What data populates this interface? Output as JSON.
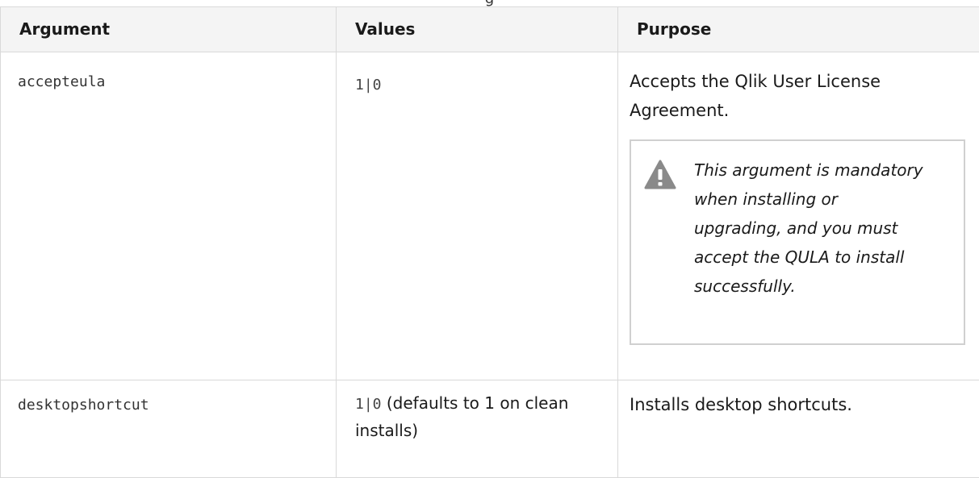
{
  "caption": "g",
  "table": {
    "headers": [
      "Argument",
      "Values",
      "Purpose"
    ],
    "rows": [
      {
        "argument": "accepteula",
        "values_code": "1|0",
        "values_note": "",
        "purpose": "Accepts the Qlik User License Agreement.",
        "note": "This argument is mandatory when installing or upgrading, and you must accept the QULA to install successfully."
      },
      {
        "argument": "desktopshortcut",
        "values_code": "1|0",
        "values_note": " (defaults to 1 on clean installs)",
        "purpose": "Installs desktop shortcuts."
      }
    ]
  },
  "icons": {
    "note": "warning-icon"
  },
  "colors": {
    "border": "#d9d9d9",
    "header_bg": "#f4f4f4",
    "icon": "#8a8a8a"
  }
}
